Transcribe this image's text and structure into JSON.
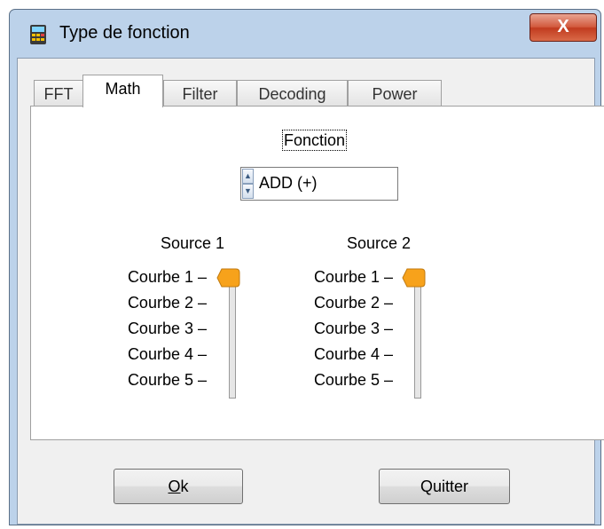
{
  "window": {
    "title": "Type de fonction",
    "close_glyph": "X"
  },
  "tabs": [
    {
      "label": "FFT"
    },
    {
      "label": "Math"
    },
    {
      "label": "Filter"
    },
    {
      "label": "Decoding"
    },
    {
      "label": "Power"
    }
  ],
  "active_tab": "Math",
  "math": {
    "fonction_label": "Fonction",
    "fonction_value": "ADD (+)",
    "source1": {
      "title": "Source 1",
      "selected": "Courbe 1"
    },
    "source2": {
      "title": "Source 2",
      "selected": "Courbe 1"
    },
    "curves": [
      "Courbe 1",
      "Courbe 2",
      "Courbe 3",
      "Courbe 4",
      "Courbe 5"
    ]
  },
  "buttons": {
    "ok_mnemonic": "O",
    "ok_rest": "k",
    "quit": "Quitter"
  },
  "colors": {
    "accent": "#f7a21b",
    "titlebar": "#bcd2ea",
    "close": "#c94a2c"
  }
}
